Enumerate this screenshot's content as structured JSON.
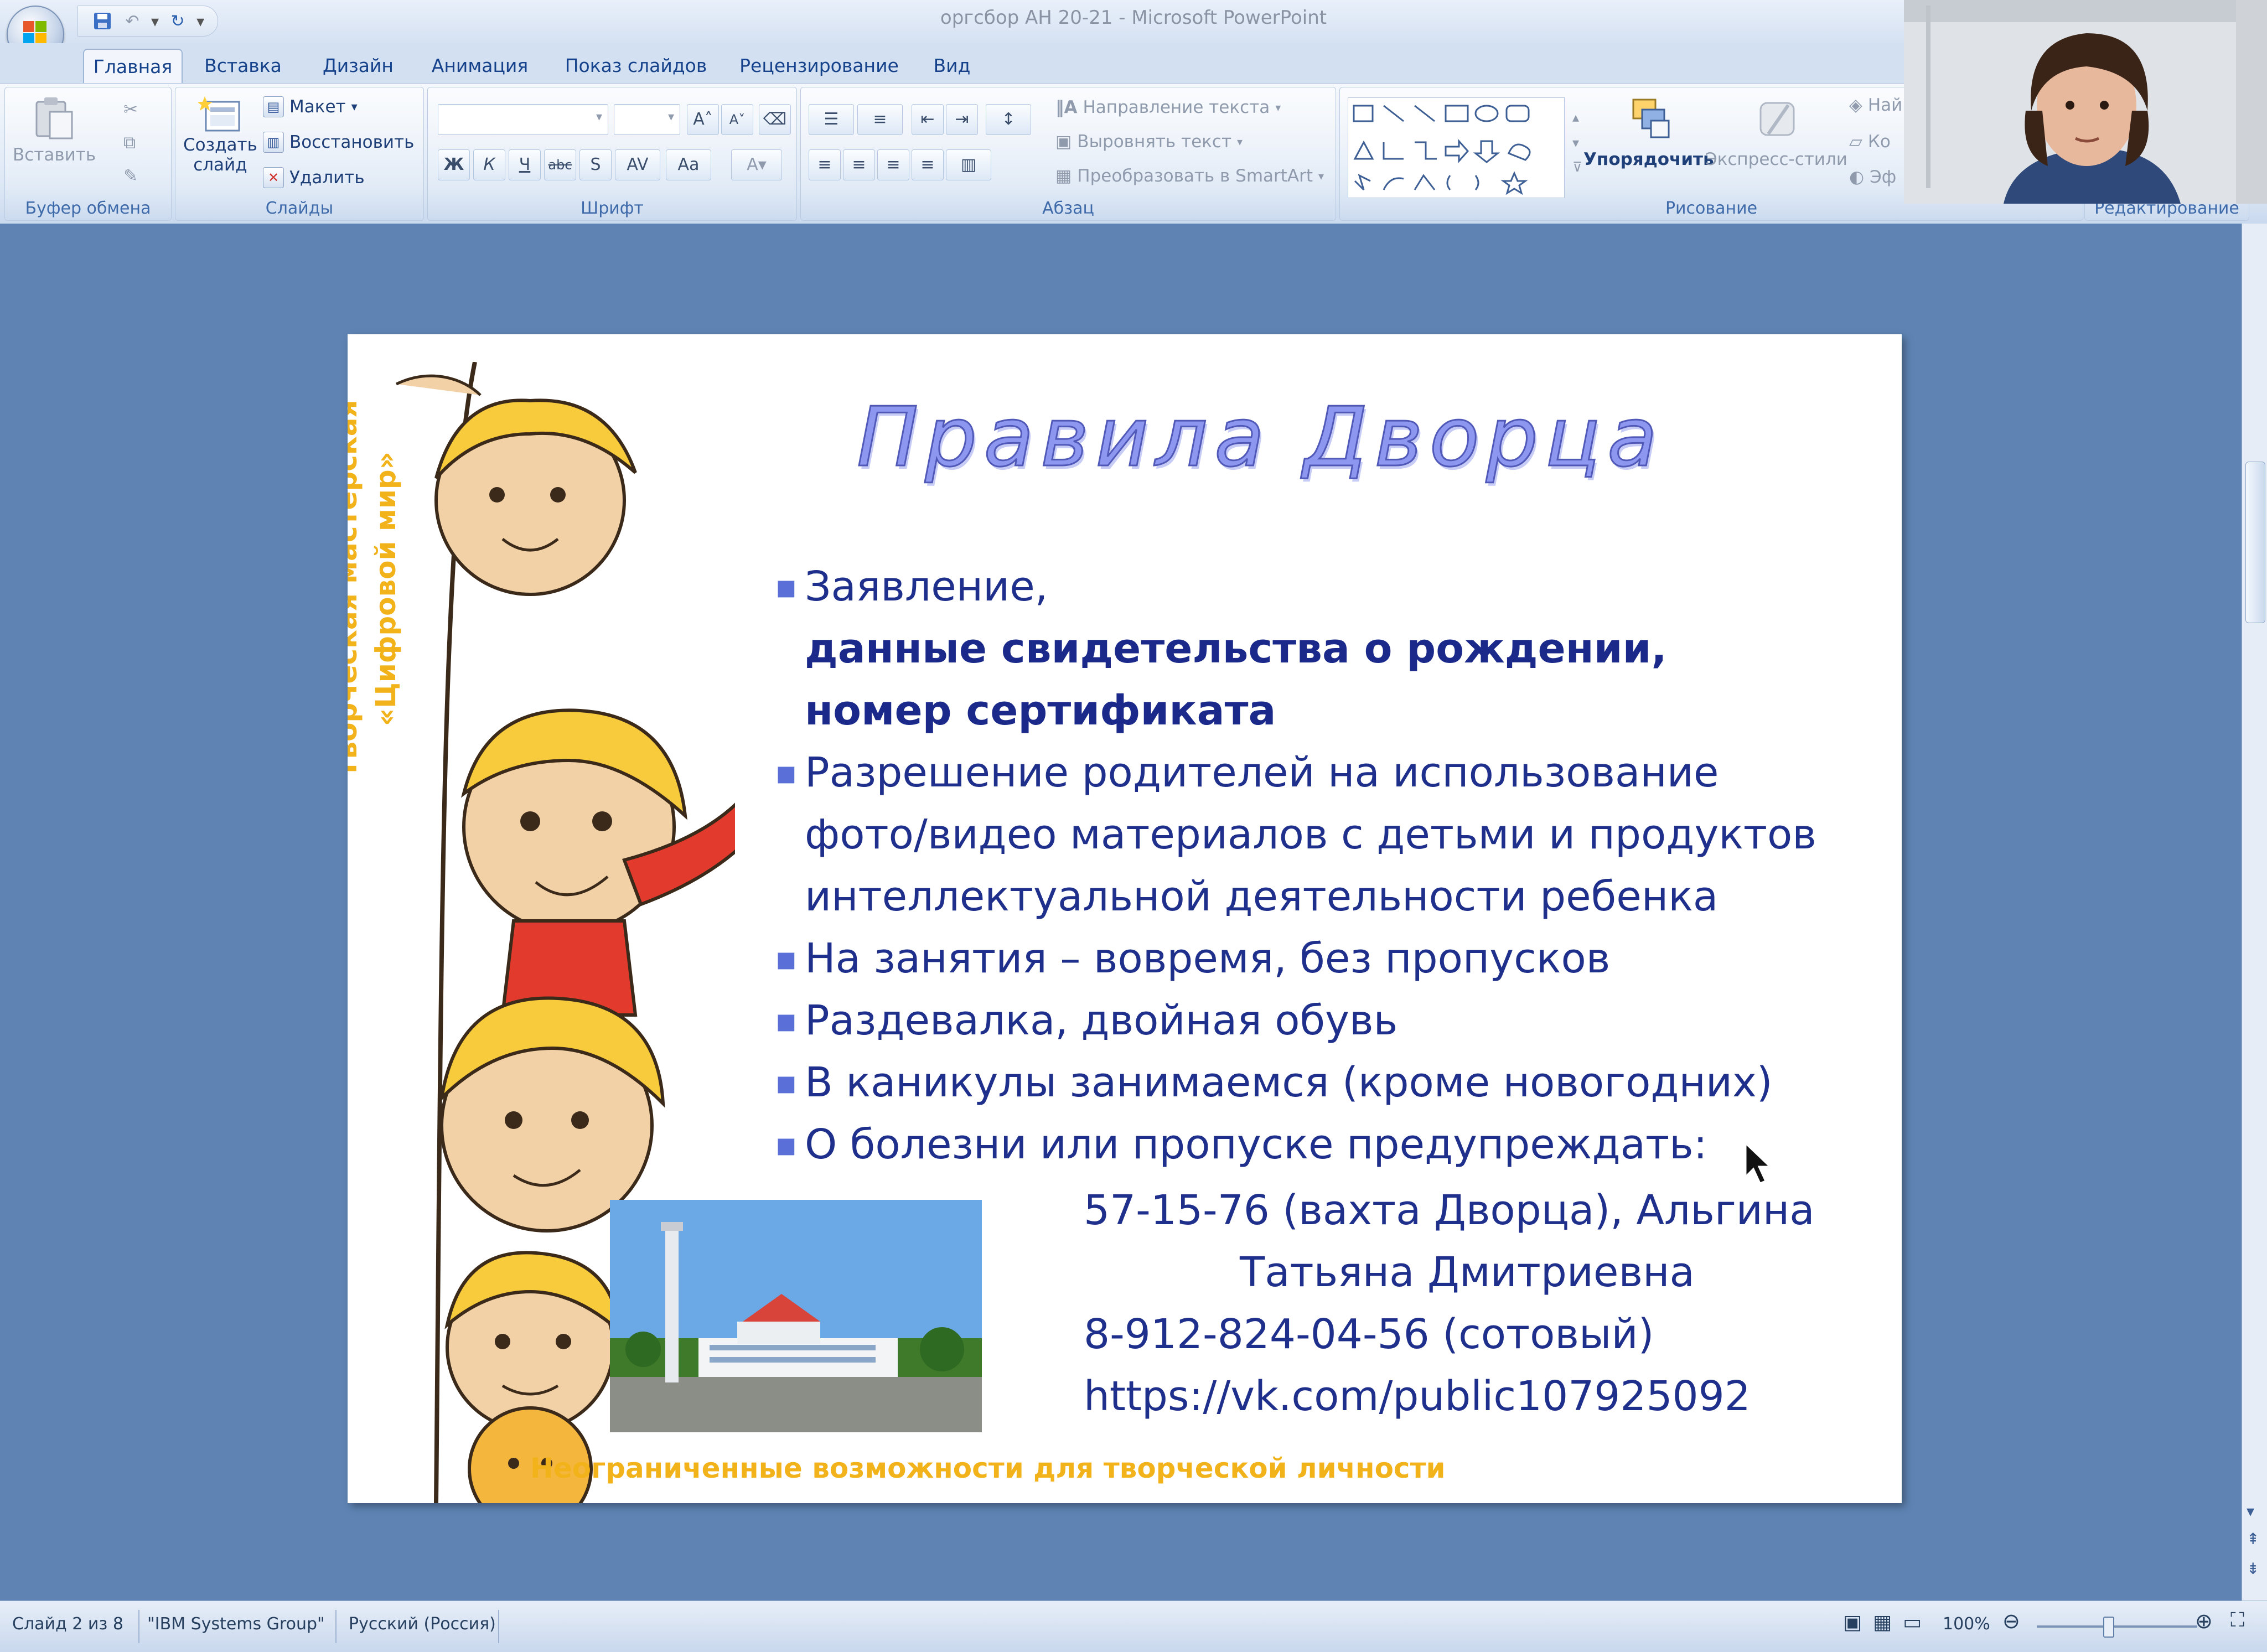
{
  "window": {
    "title": "оргсбор АН 20-21 - Microsoft PowerPoint"
  },
  "tabs": [
    {
      "label": "Главная",
      "active": true
    },
    {
      "label": "Вставка"
    },
    {
      "label": "Дизайн"
    },
    {
      "label": "Анимация"
    },
    {
      "label": "Показ слайдов"
    },
    {
      "label": "Рецензирование"
    },
    {
      "label": "Вид"
    }
  ],
  "ribbon": {
    "clipboard": {
      "paste": "Вставить",
      "label": "Буфер обмена"
    },
    "slides": {
      "new_slide_line1": "Создать",
      "new_slide_line2": "слайд",
      "layout": "Макет",
      "reset": "Восстановить",
      "delete": "Удалить",
      "label": "Слайды"
    },
    "font": {
      "bold": "Ж",
      "italic": "К",
      "underline": "Ч",
      "strike": "abc",
      "shadow": "S",
      "grow": "A",
      "shrink": "A",
      "label": "Шрифт"
    },
    "paragraph": {
      "text_direction": "Направление текста",
      "align_text": "Выровнять текст",
      "smartart": "Преобразовать в SmartArt",
      "label": "Абзац"
    },
    "drawing": {
      "arrange": "Упорядочить",
      "quick_styles": "Экспресс-стили",
      "label": "Рисование"
    },
    "editing": {
      "label": "Редактирование",
      "find": "Най",
      "replace": "Ко",
      "select": "Эф"
    }
  },
  "slide": {
    "title": "Правила Дворца",
    "bullets": [
      {
        "text": "Заявление,",
        "bullet": true,
        "bold": false
      },
      {
        "text": "данные свидетельства о рождении,",
        "bullet": false,
        "bold": true
      },
      {
        "text": "номер сертификата",
        "bullet": false,
        "bold": true
      },
      {
        "text": "Разрешение родителей на использование",
        "bullet": true,
        "bold": false
      },
      {
        "text": "фото/видео материалов с детьми и продуктов",
        "bullet": false,
        "bold": false
      },
      {
        "text": "интеллектуальной деятельности ребенка",
        "bullet": false,
        "bold": false
      },
      {
        "text": "На занятия – вовремя, без пропусков",
        "bullet": true,
        "bold": false
      },
      {
        "text": "Раздевалка, двойная обувь",
        "bullet": true,
        "bold": false
      },
      {
        "text": "В каникулы занимаемся (кроме новогодних)",
        "bullet": true,
        "bold": false
      },
      {
        "text": "О болезни или пропуске предупреждать:",
        "bullet": true,
        "bold": false
      }
    ],
    "contact": {
      "phone1": "57-15-76 (вахта Дворца), Альгина",
      "name": "Татьяна Дмитриевна",
      "phone2": "8-912-824-04-56 (сотовый)",
      "link": "https://vk.com/public107925092"
    },
    "side_line1": "Творческая мастерская",
    "side_line2": "«Цифровой мир»",
    "footer": "Неограниченные возможности для творческой личности"
  },
  "status": {
    "slide": "Слайд 2 из 8",
    "theme": "\"IBM Systems Group\"",
    "language": "Русский (Россия)",
    "zoom": "100%"
  }
}
